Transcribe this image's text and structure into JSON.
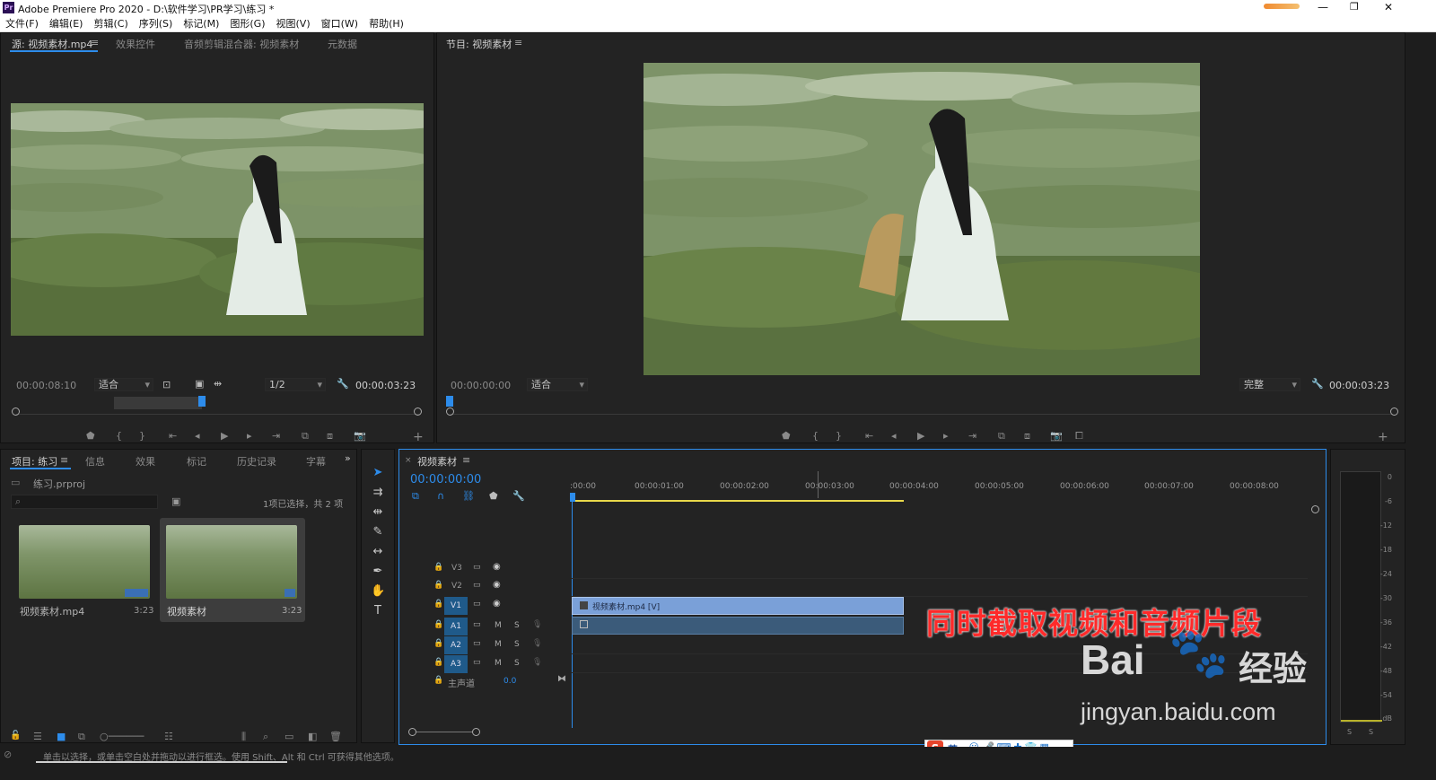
{
  "app": {
    "title": "Adobe Premiere Pro 2020 - D:\\软件学习\\PR学习\\练习 *",
    "logo": "Pr",
    "window_buttons": [
      "—",
      "❐",
      "✕"
    ]
  },
  "menu": [
    "文件(F)",
    "编辑(E)",
    "剪辑(C)",
    "序列(S)",
    "标记(M)",
    "图形(G)",
    "视图(V)",
    "窗口(W)",
    "帮助(H)"
  ],
  "source_panel": {
    "tabs": [
      "源: 视频素材.mp4",
      "效果控件",
      "音频剪辑混合器: 视频素材",
      "元数据"
    ],
    "timecode": "00:00:08:10",
    "fit": "适合",
    "resolution": "1/2",
    "duration": "00:00:03:23"
  },
  "program_panel": {
    "tab": "节目: 视频素材",
    "timecode": "00:00:00:00",
    "fit": "适合",
    "quality": "完整",
    "duration": "00:00:03:23"
  },
  "project_panel": {
    "tabs": [
      "项目: 练习",
      "信息",
      "效果",
      "标记",
      "历史记录",
      "字幕"
    ],
    "file": "练习.prproj",
    "selection_status": "1项已选择，共 2 项",
    "items": [
      {
        "name": "视频素材.mp4",
        "duration": "3:23"
      },
      {
        "name": "视频素材",
        "duration": "3:23"
      }
    ]
  },
  "timeline": {
    "tab": "视频素材",
    "timecode": "00:00:00:00",
    "ruler": [
      ":00:00",
      "00:00:01:00",
      "00:00:02:00",
      "00:00:03:00",
      "00:00:04:00",
      "00:00:05:00",
      "00:00:06:00",
      "00:00:07:00",
      "00:00:08:00"
    ],
    "video_tracks": [
      "V3",
      "V2",
      "V1"
    ],
    "audio_tracks": [
      "A1",
      "A2",
      "A3"
    ],
    "track_m": "M",
    "track_s": "S",
    "master": "主声道",
    "master_value": "0.0",
    "clip": "视频素材.mp4 [V]"
  },
  "meter": {
    "ticks": [
      "0",
      "-6",
      "-12",
      "-18",
      "-24",
      "-30",
      "-36",
      "-42",
      "-48",
      "-54",
      "dB"
    ],
    "solo": [
      "S",
      "S"
    ]
  },
  "overlay": {
    "caption": "同时截取视频和音频片段",
    "watermark_brand": "Bai",
    "watermark_brand2": "经验",
    "watermark_url": "jingyan.baidu.com"
  },
  "ime": {
    "lang": "英"
  },
  "statusbar": "单击以选择，或单击空白处并拖动以进行框选。使用 Shift、Alt 和 Ctrl 可获得其他选项。",
  "colors": {
    "accent": "#2d8ceb",
    "clip": "#7aa0d8",
    "caption": "#ff2a2a",
    "workarea": "#e8d84a"
  }
}
